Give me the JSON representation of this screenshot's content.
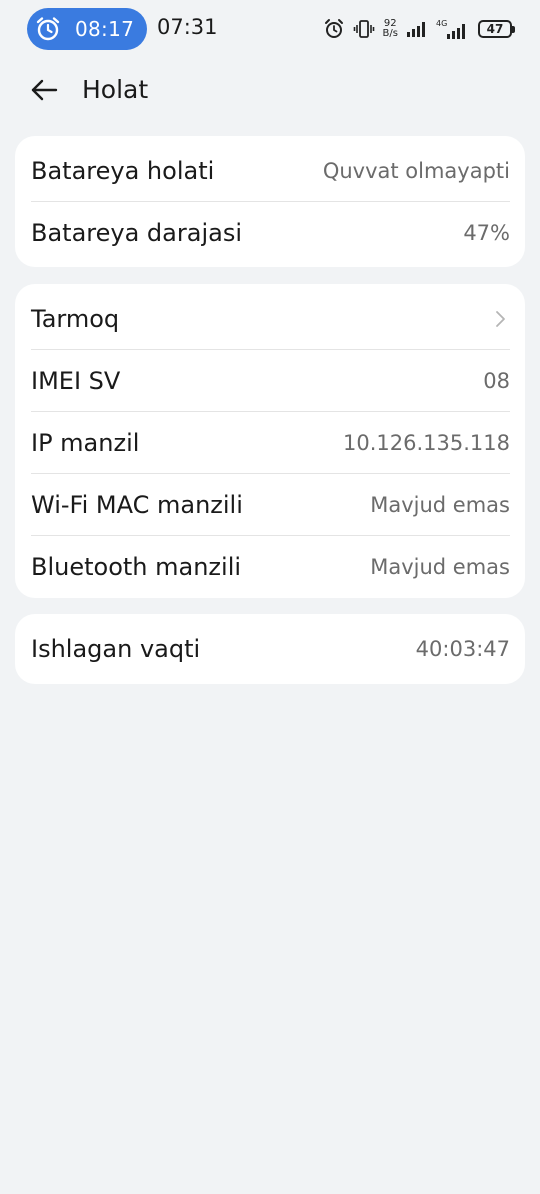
{
  "status_bar": {
    "alarm_time": "08:17",
    "clock": "07:31",
    "speed_value": "92",
    "speed_unit": "B/s",
    "network_label": "4G",
    "battery_level": "47",
    "icons": [
      "alarm-icon",
      "vibrate-icon",
      "signal-icon",
      "signal-4g-icon",
      "battery-icon"
    ]
  },
  "header": {
    "back_icon": "arrow-left-icon",
    "title": "Holat"
  },
  "battery_card": {
    "items": [
      {
        "label": "Batareya holati",
        "value": "Quvvat olmayapti"
      },
      {
        "label": "Batareya darajasi",
        "value": "47%"
      }
    ]
  },
  "network_card": {
    "items": [
      {
        "label": "Tarmoq",
        "value": "",
        "icon": "chevron-right-icon"
      },
      {
        "label": "IMEI SV",
        "value": "08"
      },
      {
        "label": "IP manzil",
        "value": "10.126.135.118"
      },
      {
        "label": "Wi-Fi MAC manzili",
        "value": "Mavjud emas"
      },
      {
        "label": "Bluetooth manzili",
        "value": "Mavjud emas"
      }
    ]
  },
  "uptime_card": {
    "items": [
      {
        "label": "Ishlagan vaqti",
        "value": "40:03:47"
      }
    ]
  },
  "colors": {
    "background": "#f1f3f5",
    "card": "#ffffff",
    "alarm_pill": "#3a7be0",
    "value_text": "#6b6b6b",
    "divider": "#e4e4e4"
  }
}
